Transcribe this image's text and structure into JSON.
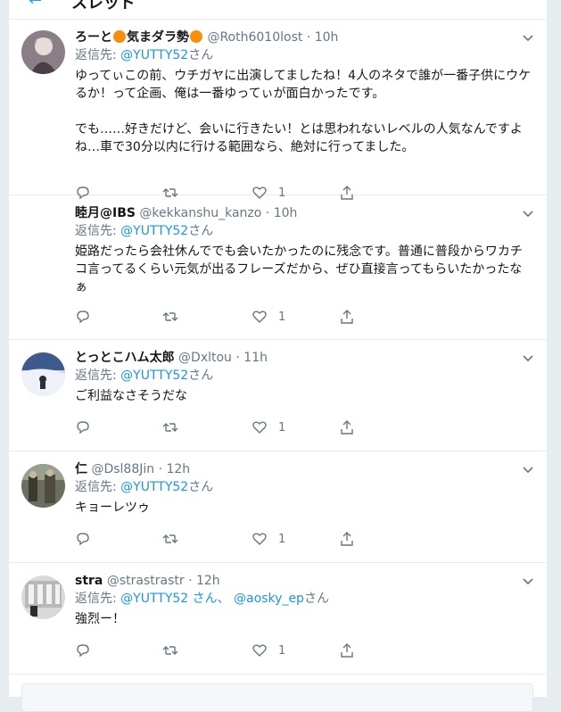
{
  "header": {
    "title": "スレッド"
  },
  "tweets": [
    {
      "name_a": "ろーと",
      "name_b": "気まダラ勢",
      "handle": "@Roth6010lost",
      "dot": "·",
      "time": "10h",
      "replying_prefix": "返信先: ",
      "replying_to": "@YUTTY52",
      "replying_suffix": "さん",
      "text": "ゆってぃこの前、ウチガヤに出演してましたね！4人のネタで誰が一番子供にウケるか！って企画、俺は一番ゆってぃが面白かったです。\n\nでも……好きだけど、会いに行きたい！とは思われないレベルの人気なんですよね…車で30分以内に行ける範囲なら、絶対に行ってました。",
      "reply_count": "",
      "retweet_count": "",
      "like_count": "1"
    },
    {
      "name": "睦月@IBS",
      "handle": "@kekkanshu_kanzo",
      "dot": "·",
      "time": "10h",
      "replying_prefix": "返信先: ",
      "replying_to": "@YUTTY52",
      "replying_suffix": "さん",
      "text": "姫路だったら会社休んででも会いたかったのに残念です。普通に普段からワカチコ言ってるくらい元気が出るフレーズだから、ぜひ直接言ってもらいたかったなぁ",
      "like_count": "1"
    },
    {
      "name": "とっとこハム太郎",
      "handle": "@Dxltou",
      "dot": "·",
      "time": "11h",
      "replying_prefix": "返信先: ",
      "replying_to": "@YUTTY52",
      "replying_suffix": "さん",
      "text": "ご利益なさそうだな",
      "like_count": "1"
    },
    {
      "name": "仁",
      "handle": "@Dsl88Jin",
      "dot": "·",
      "time": "12h",
      "replying_prefix": "返信先: ",
      "replying_to": "@YUTTY52",
      "replying_suffix": "さん",
      "text": "キョーレツゥ",
      "like_count": "1"
    },
    {
      "name": "stra",
      "handle": "@strastrastr",
      "dot": "·",
      "time": "12h",
      "replying_prefix": "返信先: ",
      "replying_to": "@YUTTY52 さん、",
      "replying_to_2": "@aosky_ep",
      "replying_suffix": "さん",
      "text": "強烈ー！",
      "like_count": "1"
    }
  ],
  "icons": {
    "reply": "reply-icon",
    "retweet": "retweet-icon",
    "like": "heart-icon",
    "share": "share-icon",
    "more": "chevron-down-icon"
  },
  "colors": {
    "link": "#1b95e0",
    "muted": "#657786",
    "emoji": "#f4900c"
  }
}
